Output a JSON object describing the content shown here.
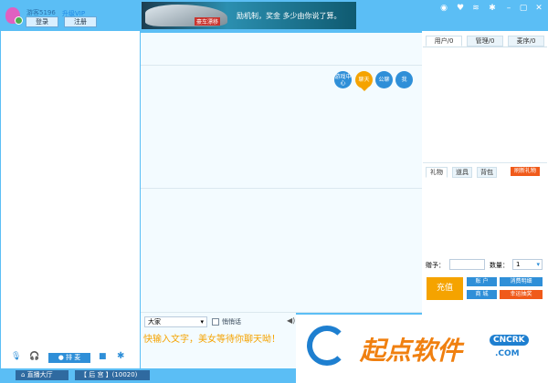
{
  "user": {
    "name": "游客5196",
    "vip_link": "升级VIP",
    "login": "登录",
    "register": "注册"
  },
  "banner": {
    "tag": "豪车漂移",
    "text": "励机制，奖金 多少由你说了算。"
  },
  "window_controls": [
    "eye-icon",
    "heart-icon",
    "wifi-icon",
    "gear-icon",
    "minimize-icon",
    "maximize-icon",
    "close-icon"
  ],
  "chat_buttons": [
    "游戏中心",
    "聊天",
    "公聊",
    "我"
  ],
  "user_tabs": [
    "用户/0",
    "管理/0",
    "麦序/0"
  ],
  "gift_tabs": [
    "礼物",
    "道具",
    "背包"
  ],
  "refresh_gifts": "刷新礼物",
  "gift_to_label": "赠予：",
  "gift_to_value": "",
  "quantity_label": "数量：",
  "quantity_value": "1",
  "recharge": "充值",
  "account": "账 户",
  "consume_detail": "消费明细",
  "shop": "商 城",
  "lucky_draw": "幸运抽奖",
  "chat_target": "大家",
  "whisper": "悄悄话",
  "input_placeholder": "快输入文字，美女等待你聊天呦！",
  "queue_mic": "排 麦",
  "bottom": {
    "hall": "直播大厅",
    "room": "【 后  宫 】(10020)"
  },
  "watermark": {
    "text": "起点软件",
    "badge": "CNCRK",
    ".com": ".COM"
  },
  "colors": {
    "accent": "#5bbef5",
    "orange": "#f5a300",
    "red": "#f05a1a",
    "blue": "#2f8fd8"
  }
}
